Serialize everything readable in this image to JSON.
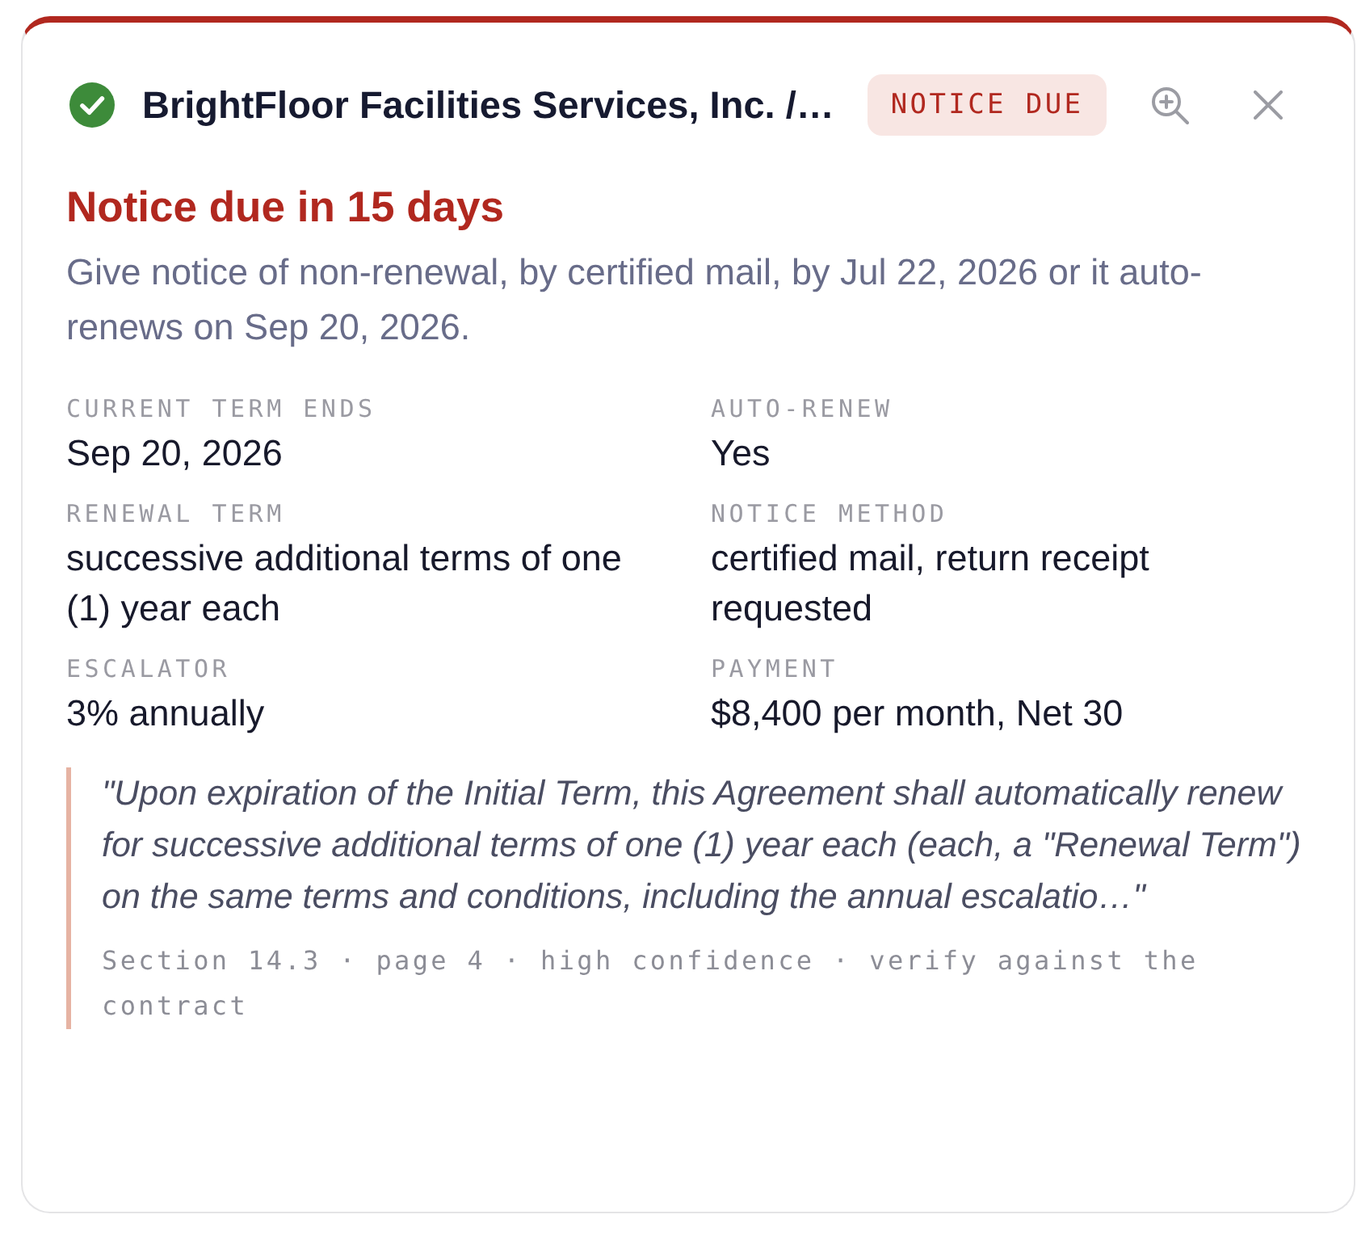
{
  "header": {
    "title": "BrightFloor Facilities Services, Inc. /…",
    "badge": "NOTICE DUE"
  },
  "alert": {
    "headline": "Notice due in 15 days",
    "description": "Give notice of non-renewal, by certified mail, by Jul 22, 2026 or it auto-renews on Sep 20, 2026."
  },
  "fields": [
    {
      "label": "CURRENT TERM ENDS",
      "value": "Sep 20, 2026"
    },
    {
      "label": "AUTO-RENEW",
      "value": "Yes"
    },
    {
      "label": "RENEWAL TERM",
      "value": "successive additional terms of one (1) year each"
    },
    {
      "label": "NOTICE METHOD",
      "value": "certified mail, return receipt requested"
    },
    {
      "label": "ESCALATOR",
      "value": "3% annually"
    },
    {
      "label": "PAYMENT",
      "value": "$8,400 per month, Net 30"
    }
  ],
  "quote": {
    "text": "\"Upon expiration of the Initial Term, this Agreement shall automatically renew for successive additional terms of one (1) year each (each, a \"Renewal Term\") on the same terms and conditions, including the annual escalatio…\"",
    "source": "Section 14.3 · page 4 · high confidence · verify against the contract"
  }
}
